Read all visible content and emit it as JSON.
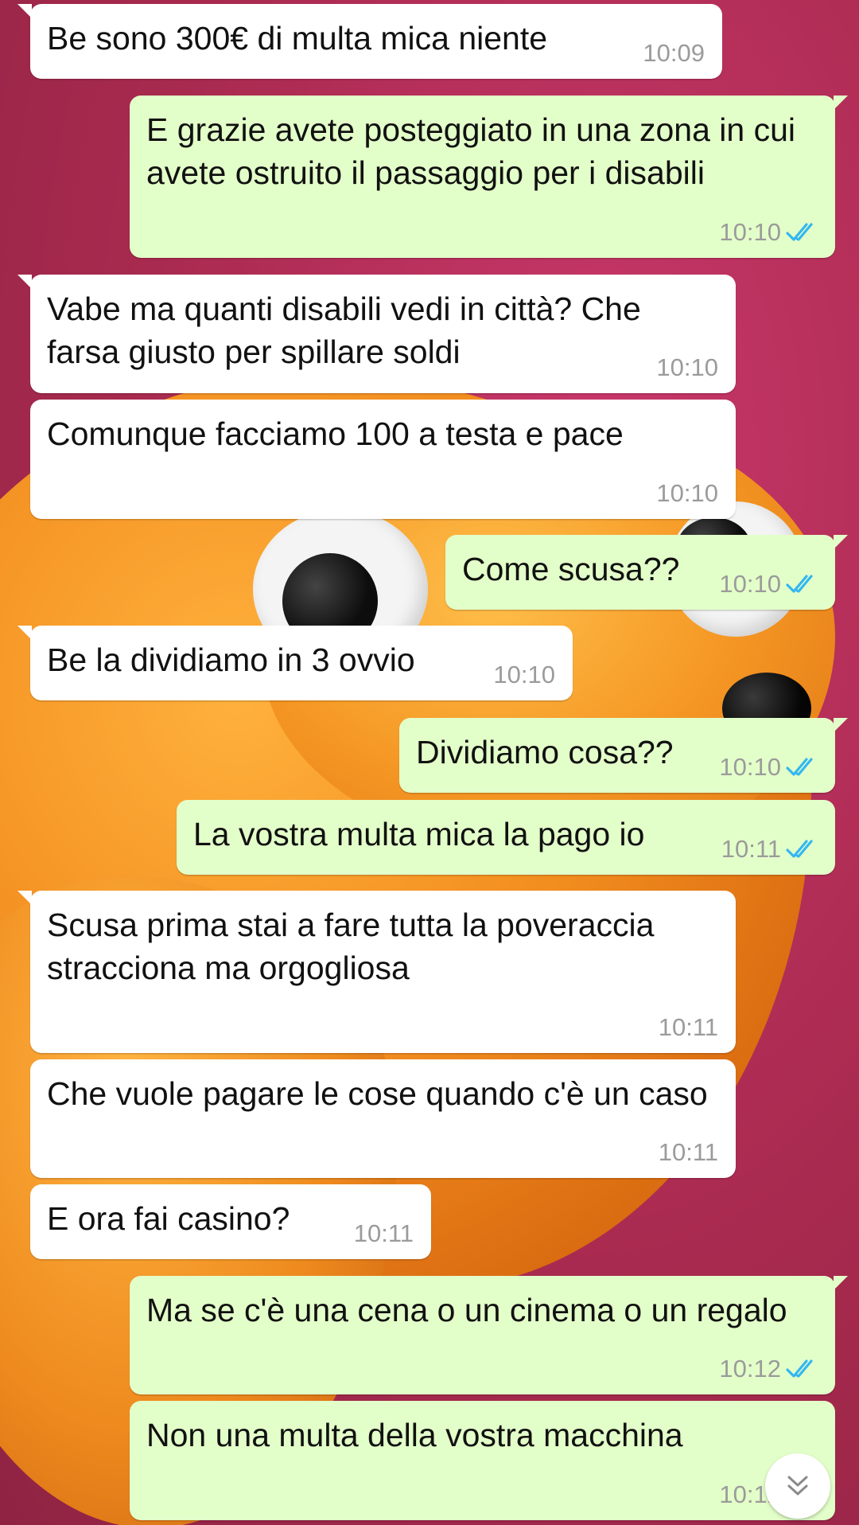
{
  "chat": {
    "messages": [
      {
        "direction": "in",
        "text": "Be sono 300€ di multa mica niente",
        "time": "10:09"
      },
      {
        "direction": "out",
        "text": "E grazie avete posteggiato in una zona in cui avete ostruito il passaggio per i disabili",
        "time": "10:10",
        "status": "read"
      },
      {
        "direction": "in",
        "text": "Vabe ma quanti disabili vedi in città? Che farsa giusto per spillare soldi",
        "time": "10:10"
      },
      {
        "direction": "in",
        "text": "Comunque facciamo 100 a testa e pace",
        "time": "10:10"
      },
      {
        "direction": "out",
        "text": "Come scusa??",
        "time": "10:10",
        "status": "read"
      },
      {
        "direction": "in",
        "text": "Be la dividiamo in 3 ovvio",
        "time": "10:10"
      },
      {
        "direction": "out",
        "text": "Dividiamo cosa??",
        "time": "10:10",
        "status": "read"
      },
      {
        "direction": "out",
        "text": "La vostra multa mica la pago io",
        "time": "10:11",
        "status": "read"
      },
      {
        "direction": "in",
        "text": "Scusa prima stai a fare tutta la poveraccia stracciona ma orgogliosa",
        "time": "10:11"
      },
      {
        "direction": "in",
        "text": "Che vuole pagare le cose quando c'è un caso",
        "time": "10:11"
      },
      {
        "direction": "in",
        "text": "E ora fai casino?",
        "time": "10:11"
      },
      {
        "direction": "out",
        "text": "Ma se c'è una cena o un cinema o un regalo",
        "time": "10:12",
        "status": "read"
      },
      {
        "direction": "out",
        "text": "Non una multa della vostra macchina",
        "time": "10:12",
        "status": "read"
      }
    ]
  },
  "colors": {
    "incoming_bubble": "#ffffff",
    "outgoing_bubble": "#e3ffc9",
    "read_ticks": "#34b7f1",
    "wallpaper": "#b32c54"
  },
  "icons": {
    "read_receipt": "double-check-icon",
    "scroll_down": "double-chevron-down-icon"
  }
}
